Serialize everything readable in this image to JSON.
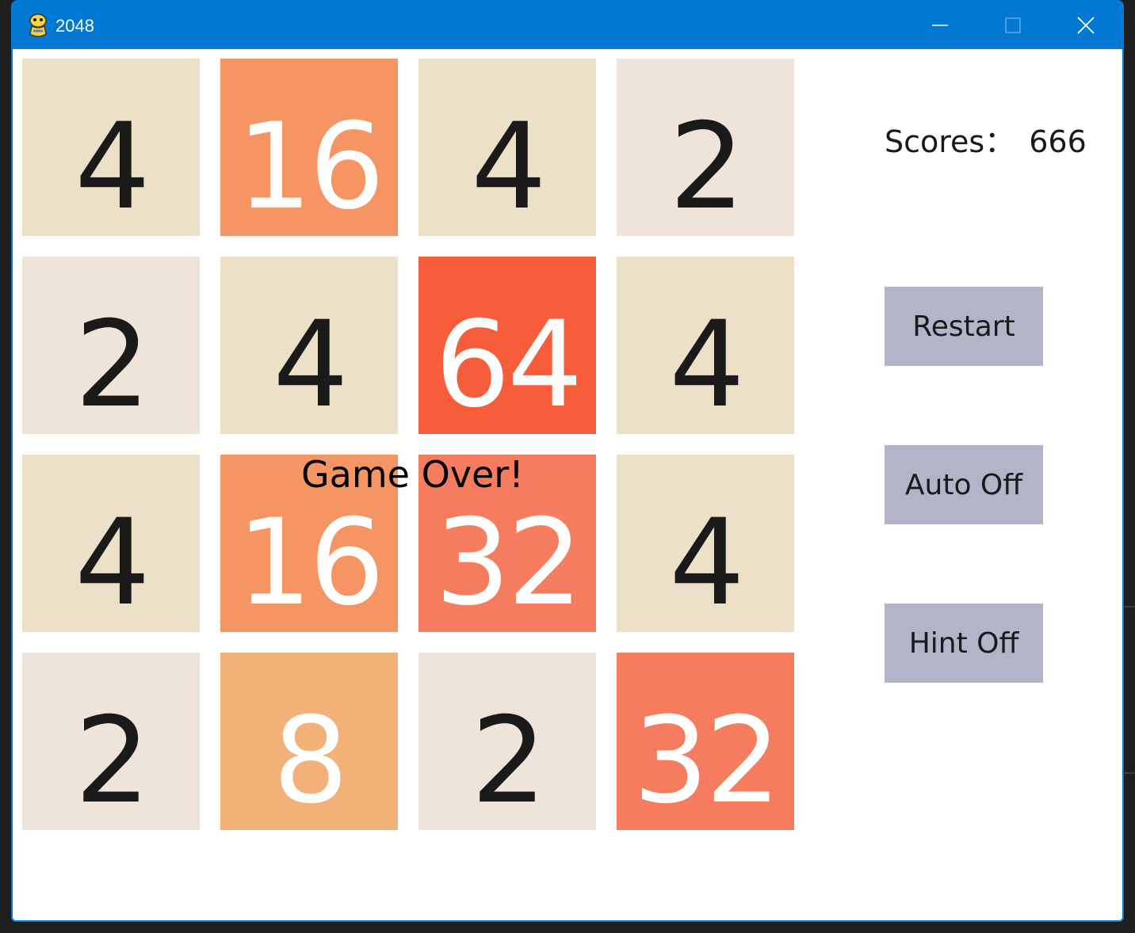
{
  "window": {
    "title": "2048",
    "icon": "python-snake-icon"
  },
  "status": {
    "message": "Game Over!"
  },
  "score": {
    "label": "Scores：",
    "value": "666"
  },
  "buttons": {
    "restart": "Restart",
    "auto": "Auto Off",
    "hint": "Hint Off"
  },
  "board": {
    "rows": [
      [
        4,
        16,
        4,
        2
      ],
      [
        2,
        4,
        64,
        4
      ],
      [
        4,
        16,
        32,
        4
      ],
      [
        2,
        8,
        2,
        32
      ]
    ]
  },
  "tile_colors": {
    "2": {
      "bg": "#eee4da",
      "fg": "#1a1a1a"
    },
    "4": {
      "bg": "#ede0c8",
      "fg": "#1a1a1a"
    },
    "8": {
      "bg": "#f2b179",
      "fg": "#ffffff"
    },
    "16": {
      "bg": "#f59563",
      "fg": "#ffffff"
    },
    "32": {
      "bg": "#f67c5f",
      "fg": "#ffffff"
    },
    "64": {
      "bg": "#f65e3b",
      "fg": "#ffffff"
    }
  },
  "colors": {
    "titlebar": "#0078d4",
    "button_bg": "#b2b4c8"
  }
}
